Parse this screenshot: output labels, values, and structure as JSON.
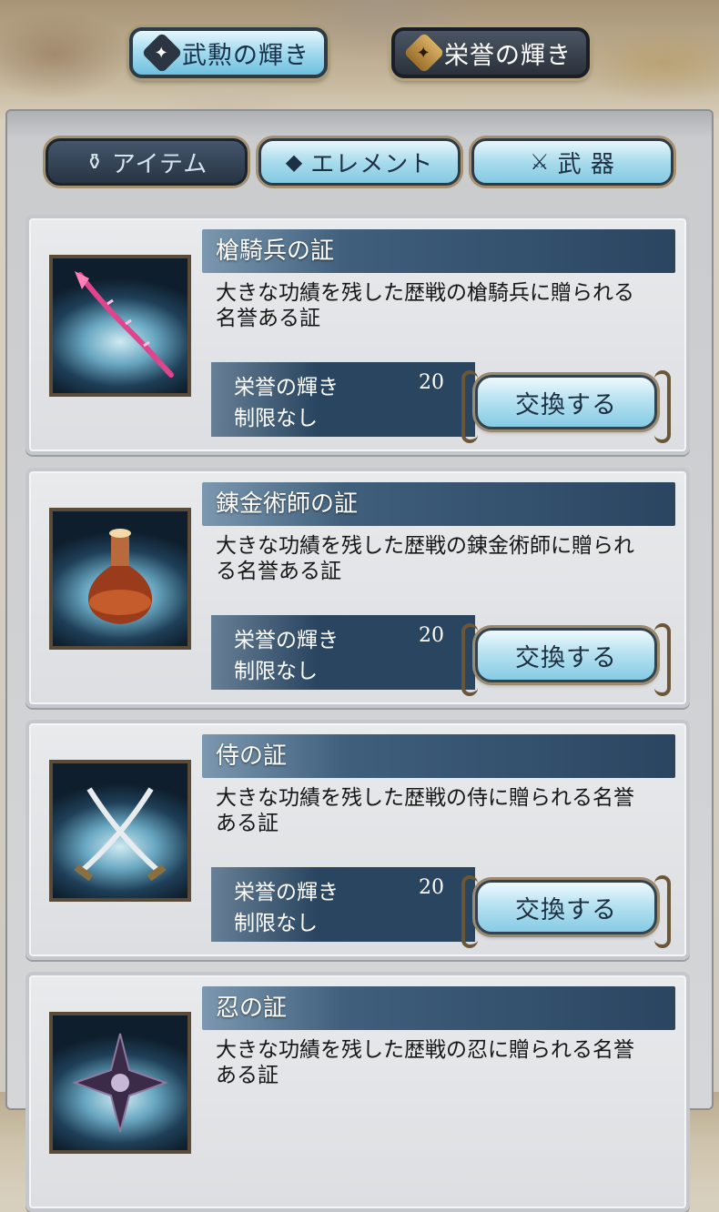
{
  "top_tabs": [
    {
      "label": "武勲の輝き",
      "icon": "star-gem-icon",
      "active": true
    },
    {
      "label": "栄誉の輝き",
      "icon": "gold-gem-icon",
      "active": false
    }
  ],
  "category_tabs": [
    {
      "label": "アイテム",
      "icon": "potion-icon",
      "active": false
    },
    {
      "label": "エレメント",
      "icon": "crystal-icon",
      "active": true
    },
    {
      "label": "武 器",
      "icon": "crossed-swords-icon",
      "active": true
    }
  ],
  "items": [
    {
      "title": "槍騎兵の証",
      "desc_line1": "大きな功績を残した歴戦の槍騎兵に贈られる",
      "desc_line2": "名誉ある証",
      "currency": "栄誉の輝き",
      "cost": "20",
      "limit": "制限なし",
      "button": "交換する",
      "icon": "spear-icon"
    },
    {
      "title": "錬金術師の証",
      "desc_line1": "大きな功績を残した歴戦の錬金術師に贈られ",
      "desc_line2": "る名誉ある証",
      "currency": "栄誉の輝き",
      "cost": "20",
      "limit": "制限なし",
      "button": "交換する",
      "icon": "flask-icon"
    },
    {
      "title": "侍の証",
      "desc_line1": "大きな功績を残した歴戦の侍に贈られる名誉",
      "desc_line2": "ある証",
      "currency": "栄誉の輝き",
      "cost": "20",
      "limit": "制限なし",
      "button": "交換する",
      "icon": "crossed-katana-icon"
    },
    {
      "title": "忍の証",
      "desc_line1": "大きな功績を残した歴戦の忍に贈られる名誉",
      "desc_line2": "ある証",
      "icon": "shuriken-icon"
    }
  ]
}
